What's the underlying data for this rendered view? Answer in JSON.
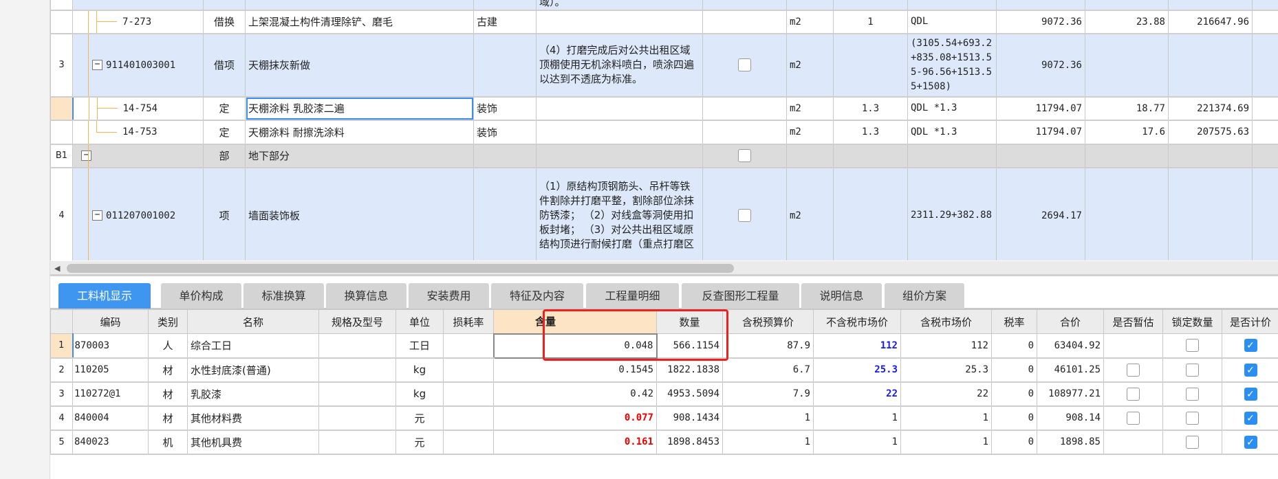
{
  "top_grid": {
    "rows": [
      {
        "num": "",
        "code": "",
        "type": "",
        "name": "",
        "specialty": "",
        "description": "域）。",
        "unit": "",
        "qty_factor": "",
        "expr": "",
        "quantity": "",
        "unit_price": "",
        "total": "",
        "style": "blue"
      },
      {
        "num": "",
        "code": "7-273",
        "type": "借换",
        "name": "上架混凝土构件清理除铲、磨毛",
        "specialty": "古建",
        "description": "",
        "unit": "m2",
        "qty_factor": "1",
        "expr": "QDL",
        "quantity": "9072.36",
        "unit_price": "23.88",
        "total": "216647.96",
        "style": "white"
      },
      {
        "num": "3",
        "code": "911401003001",
        "type": "借项",
        "name": "天棚抹灰新做",
        "specialty": "",
        "description": "（4）打磨完成后对公共出租区域顶棚使用无机涂料喷白，喷涂四遍以达到不透底为标准。",
        "unit": "m2",
        "qty_factor": "",
        "expr": "(3105.54+693.2+835.08+1513.55-96.56+1513.55+1508)",
        "quantity": "9072.36",
        "unit_price": "",
        "total": "",
        "style": "blue"
      },
      {
        "num": "",
        "code": "14-754",
        "type": "定",
        "name": "天棚涂料 乳胶漆二遍",
        "specialty": "装饰",
        "description": "",
        "unit": "m2",
        "qty_factor": "1.3",
        "expr": "QDL *1.3",
        "quantity": "11794.07",
        "unit_price": "18.77",
        "total": "221374.69",
        "style": "white"
      },
      {
        "num": "",
        "code": "14-753",
        "type": "定",
        "name": "天棚涂料 耐擦洗涂料",
        "specialty": "装饰",
        "description": "",
        "unit": "m2",
        "qty_factor": "1.3",
        "expr": "QDL *1.3",
        "quantity": "11794.07",
        "unit_price": "17.6",
        "total": "207575.63",
        "style": "white"
      },
      {
        "num": "B1",
        "code": "",
        "type": "部",
        "name": "地下部分",
        "specialty": "",
        "description": "",
        "unit": "",
        "qty_factor": "",
        "expr": "",
        "quantity": "",
        "unit_price": "",
        "total": "",
        "style": "gray"
      },
      {
        "num": "4",
        "code": "011207001002",
        "type": "项",
        "name": "墙面装饰板",
        "specialty": "",
        "description": "（1）原结构顶钢筋头、吊杆等铁件割除并打磨平整，割除部位涂抹防锈漆；\n（2）对线盒等洞使用扣板封堵；\n（3）对公共出租区域原结构顶进行耐候打磨（重点打磨区",
        "unit": "m2",
        "qty_factor": "",
        "expr": "2311.29+382.88",
        "quantity": "2694.17",
        "unit_price": "",
        "total": "",
        "style": "blue"
      }
    ]
  },
  "tabs": [
    "工料机显示",
    "单价构成",
    "标准换算",
    "换算信息",
    "安装费用",
    "特征及内容",
    "工程量明细",
    "反查图形工程量",
    "说明信息",
    "组价方案"
  ],
  "active_tab": "工料机显示",
  "bottom_grid": {
    "headers": [
      "",
      "编码",
      "类别",
      "名称",
      "规格及型号",
      "单位",
      "损耗率",
      "含量",
      "数量",
      "含税预算价",
      "不含税市场价",
      "含税市场价",
      "税率",
      "合价",
      "是否暂估",
      "锁定数量",
      "是否计价"
    ],
    "rows": [
      {
        "num": "1",
        "code": "870003",
        "type": "人",
        "name": "综合工日",
        "spec": "",
        "unit": "工日",
        "loss": "",
        "content": "0.048",
        "qty": "566.1154",
        "budget": "87.9",
        "mkt_ex": "112",
        "mkt_in": "112",
        "tax": "0",
        "total": "63404.92",
        "est": null,
        "lock": false,
        "priced": true
      },
      {
        "num": "2",
        "code": "110205",
        "type": "材",
        "name": "水性封底漆(普通)",
        "spec": "",
        "unit": "kg",
        "loss": "",
        "content": "0.1545",
        "qty": "1822.1838",
        "budget": "6.7",
        "mkt_ex": "25.3",
        "mkt_in": "25.3",
        "tax": "0",
        "total": "46101.25",
        "est": false,
        "lock": false,
        "priced": true
      },
      {
        "num": "3",
        "code": "110272@1",
        "type": "材",
        "name": "乳胶漆",
        "spec": "",
        "unit": "kg",
        "loss": "",
        "content": "0.42",
        "qty": "4953.5094",
        "budget": "7.9",
        "mkt_ex": "22",
        "mkt_in": "22",
        "tax": "0",
        "total": "108977.21",
        "est": false,
        "lock": false,
        "priced": true
      },
      {
        "num": "4",
        "code": "840004",
        "type": "材",
        "name": "其他材料费",
        "spec": "",
        "unit": "元",
        "loss": "",
        "content": "0.077",
        "qty": "908.1434",
        "budget": "1",
        "mkt_ex": "1",
        "mkt_in": "1",
        "tax": "0",
        "total": "908.14",
        "est": false,
        "lock": false,
        "priced": true
      },
      {
        "num": "5",
        "code": "840023",
        "type": "机",
        "name": "其他机具费",
        "spec": "",
        "unit": "元",
        "loss": "",
        "content": "0.161",
        "qty": "1898.8453",
        "budget": "1",
        "mkt_ex": "1",
        "mkt_in": "1",
        "tax": "0",
        "total": "1898.85",
        "est": null,
        "lock": false,
        "priced": true
      }
    ]
  },
  "colors": {
    "accent": "#3f96f0",
    "highlight_box": "#ee2020",
    "red_value": "#ee0000",
    "blue_value": "#1a1ae6",
    "tree_line": "#f5b451"
  }
}
